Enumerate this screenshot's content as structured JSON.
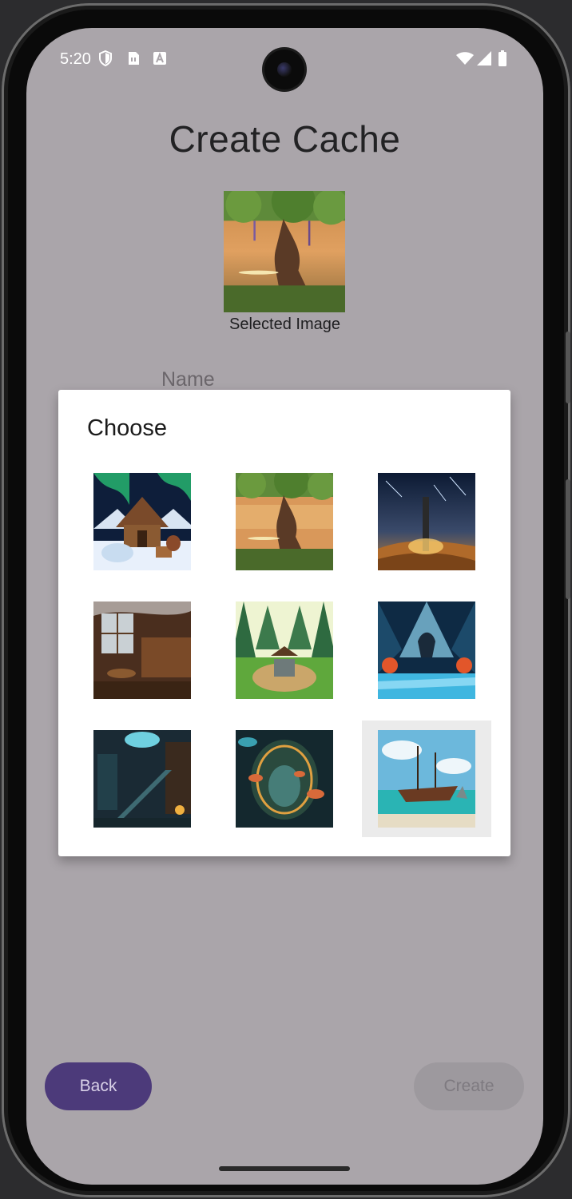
{
  "status_bar": {
    "time": "5:20",
    "left_icons": [
      "shield-icon",
      "sim-card-icon",
      "font-icon"
    ],
    "right_icons": [
      "wifi-icon",
      "cellular-icon",
      "battery-icon"
    ]
  },
  "screen": {
    "title": "Create Cache",
    "selected_image_caption": "Selected Image",
    "name_label": "Name"
  },
  "dialog": {
    "title": "Choose",
    "images": [
      {
        "subject": "snowy-cabin-aurora"
      },
      {
        "subject": "tree-on-cliff-sunset"
      },
      {
        "subject": "desert-obelisk-meteors"
      },
      {
        "subject": "tavern-interior"
      },
      {
        "subject": "forest-well"
      },
      {
        "subject": "crystal-cave-dragon"
      },
      {
        "subject": "library-staircase"
      },
      {
        "subject": "mushroom-cave-portal"
      },
      {
        "subject": "shipwreck-beach"
      }
    ],
    "selected_index": 8
  },
  "buttons": {
    "back": "Back",
    "create": "Create"
  },
  "colors": {
    "screen_background": "#aaa5aa",
    "back_button": "#4c3a7a",
    "create_button_disabled": "#9d999e",
    "dialog_background": "#ffffff"
  }
}
